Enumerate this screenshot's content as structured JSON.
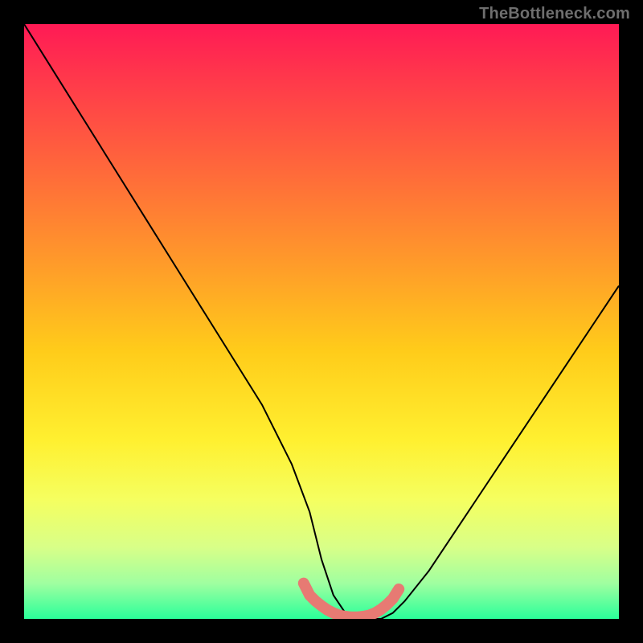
{
  "watermark": "TheBottleneck.com",
  "chart_data": {
    "type": "line",
    "title": "",
    "xlabel": "",
    "ylabel": "",
    "xlim": [
      0,
      100
    ],
    "ylim": [
      0,
      100
    ],
    "series": [
      {
        "name": "bottleneck-curve",
        "x": [
          0,
          5,
          10,
          15,
          20,
          25,
          30,
          35,
          40,
          45,
          48,
          50,
          52,
          54,
          56,
          58,
          60,
          62,
          64,
          68,
          72,
          76,
          80,
          84,
          88,
          92,
          96,
          100
        ],
        "values": [
          100,
          92,
          84,
          76,
          68,
          60,
          52,
          44,
          36,
          26,
          18,
          10,
          4,
          1,
          0,
          0,
          0,
          1,
          3,
          8,
          14,
          20,
          26,
          32,
          38,
          44,
          50,
          56
        ]
      },
      {
        "name": "valley-highlight",
        "x": [
          47,
          48,
          49,
          50,
          51,
          52,
          53,
          54,
          55,
          56,
          57,
          58,
          59,
          60,
          61,
          62,
          63
        ],
        "values": [
          6,
          4,
          3,
          2.2,
          1.5,
          1,
          0.6,
          0.4,
          0.3,
          0.3,
          0.4,
          0.6,
          1,
          1.6,
          2.4,
          3.4,
          5
        ]
      }
    ],
    "gradient_stops": [
      {
        "offset": 0.0,
        "color": "#ff1a55"
      },
      {
        "offset": 0.1,
        "color": "#ff3b4a"
      },
      {
        "offset": 0.25,
        "color": "#ff6a3a"
      },
      {
        "offset": 0.4,
        "color": "#ff9a2a"
      },
      {
        "offset": 0.55,
        "color": "#ffcc1a"
      },
      {
        "offset": 0.7,
        "color": "#fff030"
      },
      {
        "offset": 0.8,
        "color": "#f5ff60"
      },
      {
        "offset": 0.88,
        "color": "#d8ff88"
      },
      {
        "offset": 0.94,
        "color": "#a0ffa0"
      },
      {
        "offset": 1.0,
        "color": "#2aff9a"
      }
    ],
    "highlight_color": "#e77a73",
    "curve_color": "#000000"
  }
}
